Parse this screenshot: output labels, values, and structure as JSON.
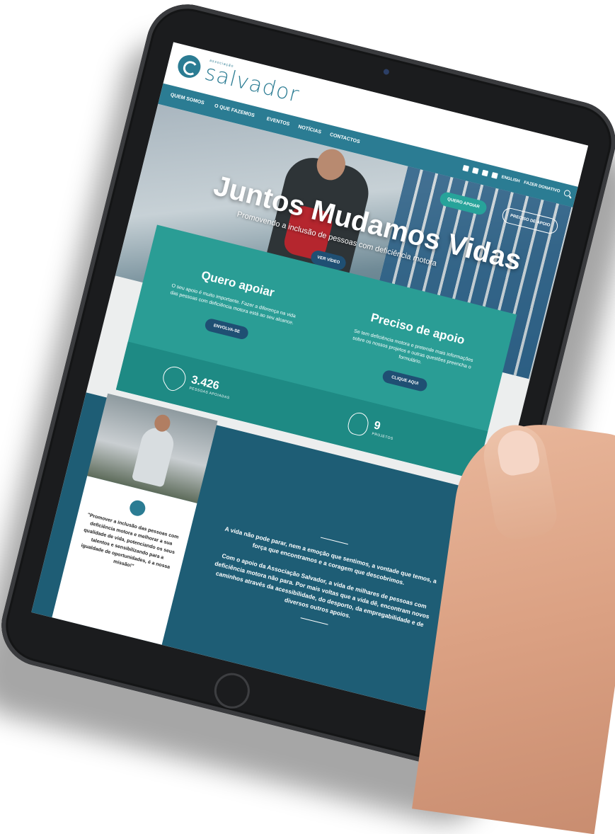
{
  "brand": {
    "small": "associação",
    "name": "salvador"
  },
  "nav": {
    "items": [
      "QUEM SOMOS",
      "O QUE FAZEMOS",
      "EVENTOS",
      "NOTÍCIAS",
      "CONTACTOS"
    ],
    "lang": "ENGLISH",
    "donate": "FAZER DONATIVO"
  },
  "hero": {
    "btn_apoiar": "QUERO APOIAR",
    "btn_preciso": "PRECISO DE APOIO",
    "title": "Juntos Mudamos Vidas",
    "subtitle": "Promovendo a inclusão de pessoas com deficiência motora",
    "video": "VER VÍDEO"
  },
  "cards": {
    "left": {
      "title": "Quero apoiar",
      "text": "O seu apoio é muito importante. Fazer a diferença na vida das pessoas com deficiência motora está ao seu alcance.",
      "button": "ENVOLVA-SE"
    },
    "right": {
      "title": "Preciso de apoio",
      "text": "Se tem deficiência motora e pretende mais informações sobre os nossos projetos e outras questões preencha o formulário.",
      "button": "CLIQUE AQUI"
    }
  },
  "stats": {
    "people": {
      "value": "3.426",
      "label": "PESSOAS APOIADAS"
    },
    "projects": {
      "value": "9",
      "label": "PROJETOS"
    }
  },
  "story": {
    "quote": "\"Promover a inclusão das pessoas com deficiência motora e melhorar a sua qualidade de vida, potenciando os seus talentos e sensibilizando para a igualdade de oportunidades, é a nossa missão!\"",
    "p1": "A vida não pode parar, nem a emoção que sentimos, a vontade que temos, a força que encontramos e a coragem que descobrimos.",
    "p2": "Com o apoio da Associação Salvador, a vida de milhares de pessoas com deficiência motora não para. Por mais voltas que a vida dê, encontram novos caminhos através da acessibilidade, do desporto, da empregabilidade e de diversos outros apoios."
  },
  "colors": {
    "brand": "#2b7c93",
    "teal": "#2a9d95",
    "navy": "#1f4f73"
  }
}
